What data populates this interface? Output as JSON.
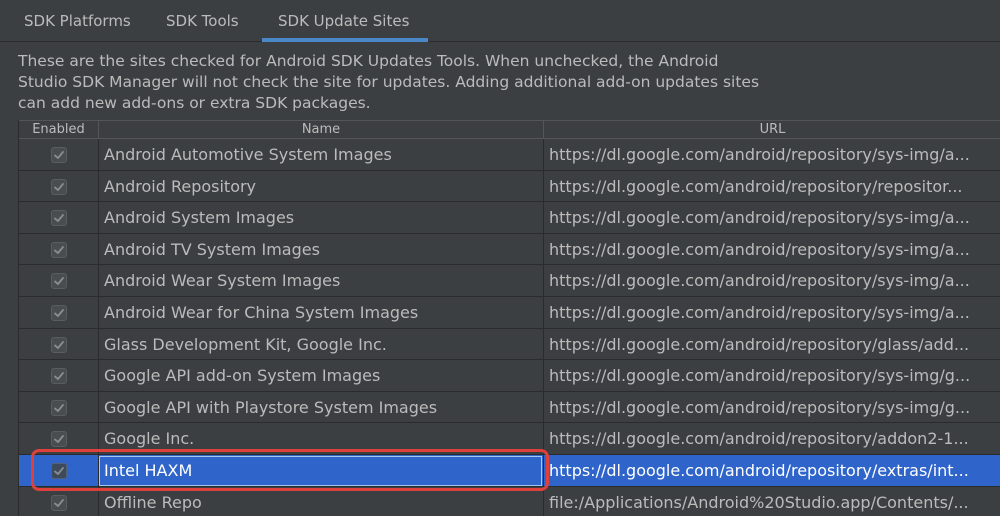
{
  "tabs": [
    {
      "label": "SDK Platforms"
    },
    {
      "label": "SDK Tools"
    },
    {
      "label": "SDK Update Sites"
    }
  ],
  "active_tab": "SDK Update Sites",
  "description": {
    "line1": "These are the sites checked for Android SDK Updates Tools. When unchecked, the Android",
    "line2": "Studio SDK Manager will not check the site for updates. Adding additional add-on updates sites",
    "line3": "can add new add-ons or extra SDK packages."
  },
  "table": {
    "headers": {
      "enabled": "Enabled",
      "name": "Name",
      "url": "URL"
    },
    "rows": [
      {
        "enabled": true,
        "name": "Android Automotive System Images",
        "url": "https://dl.google.com/android/repository/sys-img/a..."
      },
      {
        "enabled": true,
        "name": "Android Repository",
        "url": "https://dl.google.com/android/repository/repositor..."
      },
      {
        "enabled": true,
        "name": "Android System Images",
        "url": "https://dl.google.com/android/repository/sys-img/a..."
      },
      {
        "enabled": true,
        "name": "Android TV System Images",
        "url": "https://dl.google.com/android/repository/sys-img/a..."
      },
      {
        "enabled": true,
        "name": "Android Wear System Images",
        "url": "https://dl.google.com/android/repository/sys-img/a..."
      },
      {
        "enabled": true,
        "name": "Android Wear for China System Images",
        "url": "https://dl.google.com/android/repository/sys-img/a..."
      },
      {
        "enabled": true,
        "name": "Glass Development Kit, Google Inc.",
        "url": "https://dl.google.com/android/repository/glass/add..."
      },
      {
        "enabled": true,
        "name": "Google API add-on System Images",
        "url": "https://dl.google.com/android/repository/sys-img/g..."
      },
      {
        "enabled": true,
        "name": "Google API with Playstore System Images",
        "url": "https://dl.google.com/android/repository/sys-img/g..."
      },
      {
        "enabled": true,
        "name": "Google Inc.",
        "url": "https://dl.google.com/android/repository/addon2-1..."
      },
      {
        "enabled": true,
        "name": "Intel HAXM",
        "url": "https://dl.google.com/android/repository/extras/int...",
        "selected": true
      },
      {
        "enabled": true,
        "name": "Offline Repo",
        "url": "file:/Applications/Android%20Studio.app/Contents/..."
      }
    ]
  },
  "colors": {
    "background": "#3c3f41",
    "accent": "#4a88c7",
    "selection": "#2f65ca",
    "highlight": "#e0403c"
  }
}
